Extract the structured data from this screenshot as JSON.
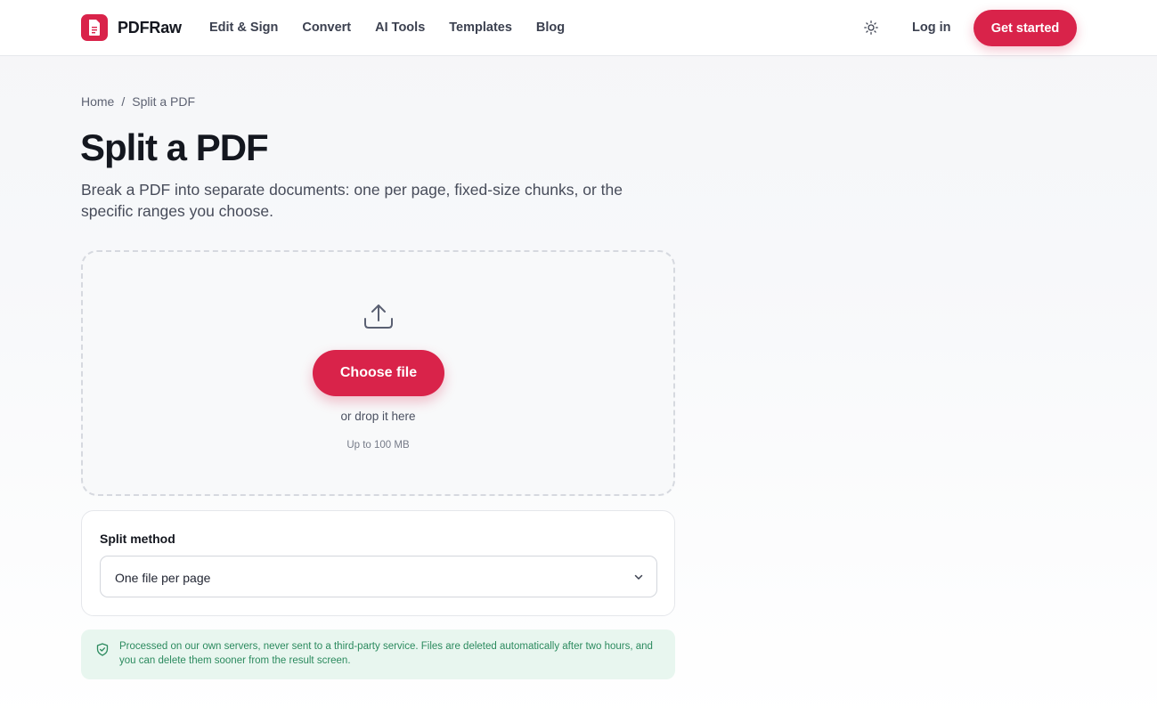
{
  "brand": {
    "name": "PDFRaw",
    "accent": "#d9234a"
  },
  "nav": [
    "Edit & Sign",
    "Convert",
    "AI Tools",
    "Templates",
    "Blog"
  ],
  "header": {
    "theme_icon": "sun-icon",
    "login_label": "Log in",
    "cta_label": "Get started"
  },
  "breadcrumb": {
    "home": "Home",
    "separator": "/",
    "current": "Split a PDF"
  },
  "page": {
    "title": "Split a PDF",
    "subtitle": "Break a PDF into separate documents: one per page, fixed-size chunks, or the specific ranges you choose."
  },
  "dropzone": {
    "icon": "upload-icon",
    "button_label": "Choose file",
    "drop_text": "or drop it here",
    "limit_text": "Up to 100 MB"
  },
  "split_method": {
    "label": "Split method",
    "selected": "One file per page"
  },
  "notice": {
    "icon": "shield-check-icon",
    "text": "Processed on our own servers, never sent to a third-party service. Files are deleted automatically after two hours, and you can delete them sooner from the result screen.",
    "color": "#2b8a5e"
  }
}
